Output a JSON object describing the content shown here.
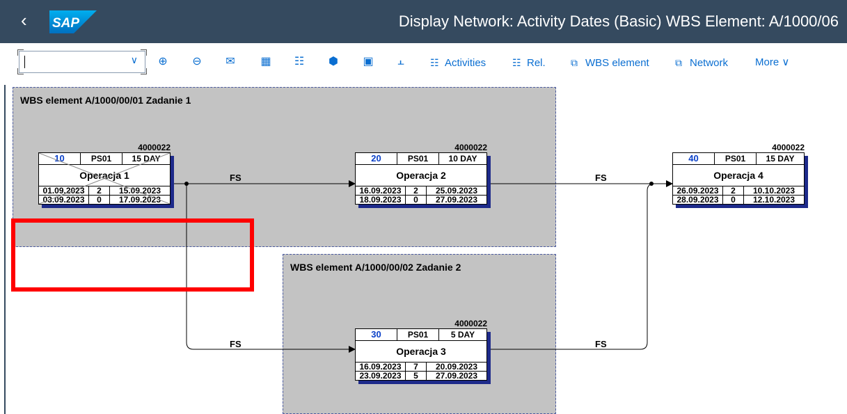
{
  "shell": {
    "title": "Display Network:  Activity Dates (Basic) WBS Element: A/1000/06",
    "logo_text": "SAP",
    "back_icon": "chevron-left-icon"
  },
  "toolbar": {
    "combo_value": "",
    "icons": [
      "zoom-in-icon",
      "zoom-out-icon",
      "mail-icon",
      "grid-select-icon",
      "grid-deselect-icon",
      "cube-icon",
      "image-icon",
      "bar-align-icon"
    ],
    "activities_label": "Activities",
    "rel_label": "Rel.",
    "wbs_element_label": "WBS element",
    "network_label": "Network",
    "more_label": "More"
  },
  "wbs": [
    {
      "label": "WBS element A/1000/00/01 Zadanie 1"
    },
    {
      "label": "WBS element A/1000/00/02 Zadanie 2"
    }
  ],
  "nodes": [
    {
      "id": "4000022",
      "num": "10",
      "plant": "PS01",
      "dur": "15 DAY",
      "name": "Operacja 1",
      "es": "01.09.2023",
      "ff": "2",
      "ef": "15.09.2023",
      "ls": "03.09.2023",
      "tf": "0",
      "lf": "17.09.2023",
      "crossed": true
    },
    {
      "id": "4000022",
      "num": "20",
      "plant": "PS01",
      "dur": "10 DAY",
      "name": "Operacja 2",
      "es": "16.09.2023",
      "ff": "2",
      "ef": "25.09.2023",
      "ls": "18.09.2023",
      "tf": "0",
      "lf": "27.09.2023",
      "crossed": false
    },
    {
      "id": "4000022",
      "num": "30",
      "plant": "PS01",
      "dur": "5 DAY",
      "name": "Operacja 3",
      "es": "16.09.2023",
      "ff": "7",
      "ef": "20.09.2023",
      "ls": "23.09.2023",
      "tf": "5",
      "lf": "27.09.2023",
      "crossed": false
    },
    {
      "id": "4000022",
      "num": "40",
      "plant": "PS01",
      "dur": "15 DAY",
      "name": "Operacja 4",
      "es": "26.09.2023",
      "ff": "2",
      "ef": "10.10.2023",
      "ls": "28.09.2023",
      "tf": "0",
      "lf": "12.10.2023",
      "crossed": false
    }
  ],
  "relations": [
    {
      "label": "FS"
    },
    {
      "label": "FS"
    },
    {
      "label": "FS"
    },
    {
      "label": "FS"
    }
  ],
  "colors": {
    "shell": "#354a5f",
    "accent": "#0a6ed1",
    "wbs_fill": "#c3c3c3",
    "node_shadow": "#1d2a8a",
    "highlight": "#ff0000"
  }
}
